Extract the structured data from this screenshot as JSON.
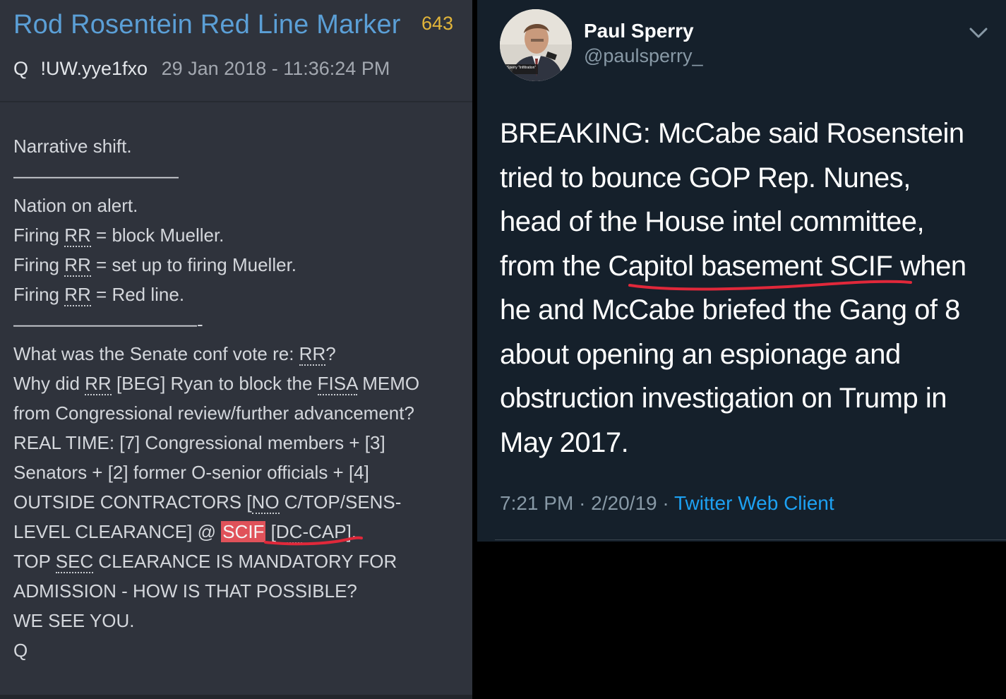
{
  "q_post": {
    "title": "Rod Rosentein Red Line Marker",
    "post_number": "643",
    "author": "Q",
    "tripcode": "!UW.yye1fxo",
    "date": "29 Jan 2018 - 11:36:24 PM",
    "lines": {
      "l1": "Narrative shift.",
      "l2": "—————————",
      "l3": "Nation on alert.",
      "l4_pre": "Firing ",
      "rr": "RR",
      "l4_post": " = block Mueller.",
      "l5_post": " = set up to firing Mueller.",
      "l6_post": " = Red line.",
      "l7": "——————————-",
      "l8_pre": "What was the Senate conf vote re: ",
      "l8_post": "?",
      "l9_pre": "Why did ",
      "l9_mid": " [BEG] Ryan to block the ",
      "fisa": "FISA",
      "l9_post": " MEMO",
      "l10": "from Congressional review/further advancement?",
      "l11": "REAL TIME: [7] Congressional members + [3]",
      "l12": "Senators + [2] former O-senior officials + [4]",
      "l13_pre": "OUTSIDE CONTRACTORS [",
      "no": "NO",
      "l13_post": " C/TOP/SENS-",
      "l14_pre": "LEVEL CLEARANCE] @ ",
      "scif": "SCIF",
      "l14_mid": " [",
      "dc": "DC",
      "l14_post": "-CAP].",
      "l15_pre": "TOP ",
      "sec": "SEC",
      "l15_post": " CLEARANCE IS MANDATORY FOR",
      "l16": "ADMISSION - HOW IS THAT POSSIBLE?",
      "l17": "WE SEE YOU.",
      "l18": "Q"
    }
  },
  "tweet": {
    "name": "Paul Sperry",
    "handle": "@paulsperry_",
    "avatar_caption": "Sperry “Infiltration”",
    "lines": {
      "l1": "BREAKING: McCabe said Rosenstein",
      "l2": "tried to bounce GOP Rep. Nunes,",
      "l3": "head of the House intel committee,",
      "l4": "from the Capitol basement SCIF when",
      "l5": "he and McCabe briefed the Gang of 8",
      "l6": "about opening an espionage and",
      "l7": "obstruction investigation on Trump in",
      "l8": "May 2017."
    },
    "time": "7:21 PM",
    "date": "2/20/19",
    "dot": "·",
    "client": "Twitter Web Client"
  },
  "colors": {
    "left_bg": "#2f333c",
    "title_blue": "#5b9fd6",
    "count_yellow": "#e2b53a",
    "highlight_red": "#e0525a",
    "twitter_bg": "#15202b",
    "twitter_blue": "#1da1f2",
    "marker_red": "#e0283a"
  }
}
